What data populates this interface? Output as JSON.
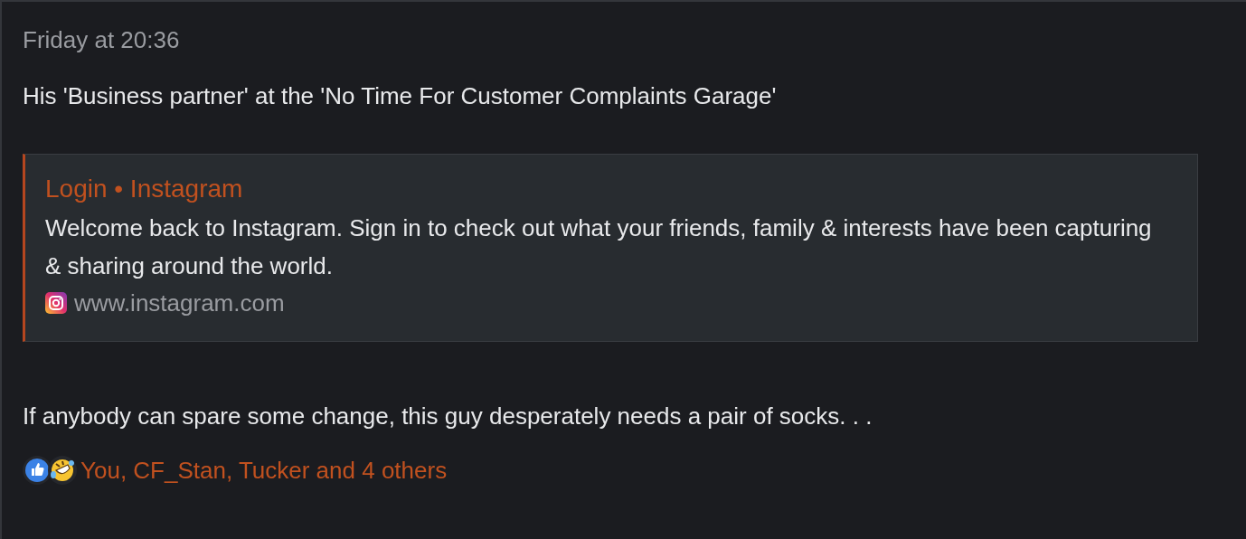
{
  "post": {
    "timestamp": "Friday at 20:36",
    "message": "His 'Business partner' at the 'No Time For Customer Complaints Garage'",
    "link_preview": {
      "title": "Login • Instagram",
      "description": "Welcome back to Instagram. Sign in to check out what your friends, family & interests have been capturing & sharing around the world.",
      "domain": "www.instagram.com"
    },
    "message_2": "If anybody can spare some change, this guy desperately needs a pair of socks. . .",
    "reactions": {
      "summary": "You, CF_Stan, Tucker and 4 others"
    }
  }
}
